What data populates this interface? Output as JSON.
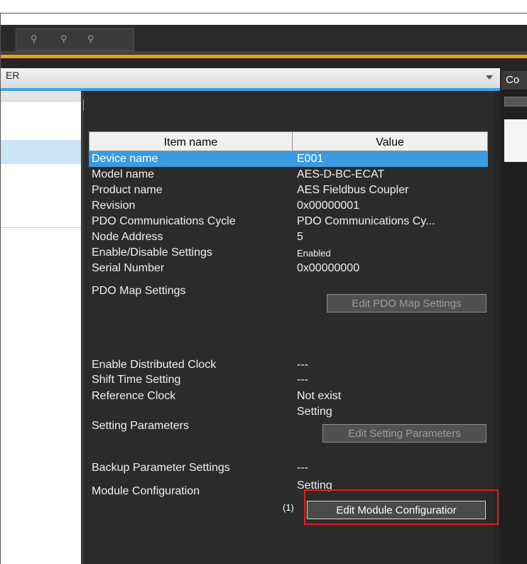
{
  "right_panel": {
    "tab_label": "Co",
    "text1": "C",
    "text2": "ER"
  },
  "grid": {
    "columns": [
      "Item name",
      "Value"
    ],
    "rows": [
      {
        "name": "Device name",
        "value": "E001",
        "selected": true
      },
      {
        "name": "Model name",
        "value": "AES-D-BC-ECAT"
      },
      {
        "name": "Product name",
        "value": "AES Fieldbus Coupler"
      },
      {
        "name": "Revision",
        "value": "0x00000001"
      },
      {
        "name": "PDO Communications Cycle",
        "value": "PDO Communications Cy..."
      },
      {
        "name": "Node Address",
        "value": "5"
      },
      {
        "name": "Enable/Disable Settings",
        "value": "Enabled"
      },
      {
        "name": "Serial Number",
        "value": "0x00000000"
      },
      {
        "name": "PDO Map Settings",
        "button": "Edit PDO Map Settings"
      },
      {
        "name": "Enable Distributed Clock",
        "value": "---"
      },
      {
        "name": "Shift Time Setting",
        "value": "---"
      },
      {
        "name": "Reference Clock",
        "value": "Not exist"
      },
      {
        "name": "Setting Parameters",
        "value": "Setting",
        "button": "Edit Setting Parameters"
      },
      {
        "name": "Backup Parameter Settings",
        "value": "---"
      },
      {
        "name": "Module Configuration",
        "value": "Setting",
        "button": "Edit Module Configuratior",
        "callout": "(1)"
      }
    ]
  },
  "colors": {
    "selection": "#3a9be0",
    "accent": "#e8a019",
    "header_underline": "#3ea0e6",
    "callout": "#e0201a"
  }
}
